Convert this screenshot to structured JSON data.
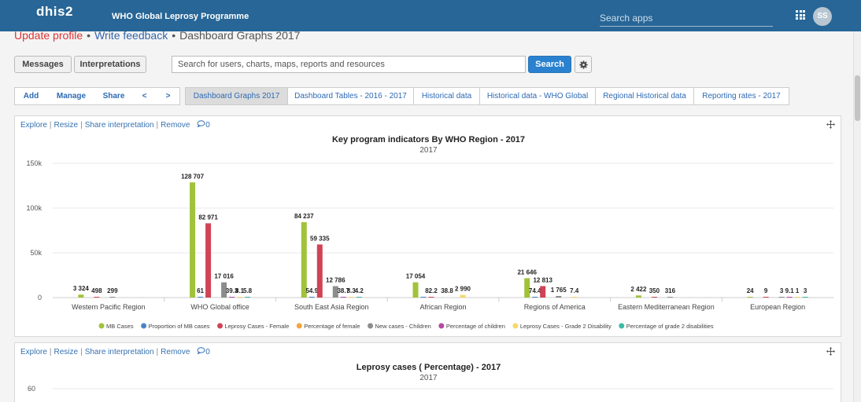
{
  "header": {
    "logo": "dhis2",
    "title": "WHO Global Leprosy Programme",
    "search_placeholder": "Search apps",
    "avatar_initials": "SS"
  },
  "breadcrumb": {
    "update_profile": "Update profile",
    "write_feedback": "Write feedback",
    "current": "Dashboard Graphs 2017",
    "separator": "•"
  },
  "toolbar": {
    "messages": "Messages",
    "interpretations": "Interpretations",
    "search_placeholder": "Search for users, charts, maps, reports and resources",
    "search_button": "Search"
  },
  "dashboard_controls": {
    "add": "Add",
    "manage": "Manage",
    "share": "Share",
    "prev": "<",
    "next": ">"
  },
  "tabs": [
    "Dashboard Graphs 2017",
    "Dashboard Tables - 2016 - 2017",
    "Historical data",
    "Historical data - WHO Global",
    "Regional Historical data",
    "Reporting rates - 2017"
  ],
  "panel_links": {
    "explore": "Explore",
    "resize": "Resize",
    "share_interpretation": "Share interpretation",
    "remove": "Remove",
    "comment_count": "0",
    "separator": "|"
  },
  "chart_data": [
    {
      "type": "bar",
      "title": "Key program indicators By WHO Region - 2017",
      "subtitle": "2017",
      "ylim": [
        0,
        150000
      ],
      "yticks": [
        0,
        50000,
        100000,
        150000
      ],
      "ytick_labels": [
        "0",
        "50k",
        "100k",
        "150k"
      ],
      "grid": true,
      "legend_position": "bottom",
      "categories": [
        "Western Pacific Region",
        "WHO Global office",
        "South East Asia Region",
        "African Region",
        "Regions of America",
        "Eastern Mediterranean Region",
        "European Region"
      ],
      "series": [
        {
          "name": "MB Cases",
          "color": "#a0c33a",
          "values": [
            3324,
            128707,
            84237,
            17054,
            21646,
            2422,
            24
          ]
        },
        {
          "name": "Proportion of MB cases",
          "color": "#4a84c7",
          "values": [
            null,
            61,
            54.9,
            82.2,
            74.4,
            null,
            null
          ]
        },
        {
          "name": "Leprosy Cases - Female",
          "color": "#d14356",
          "values": [
            498,
            82971,
            59335,
            38.8,
            12813,
            350,
            9
          ]
        },
        {
          "name": "Percentage of female",
          "color": "#f4a43c",
          "values": [
            null,
            null,
            null,
            null,
            null,
            null,
            null
          ]
        },
        {
          "name": "New cases - Children",
          "color": "#8d8d8d",
          "values": [
            299,
            17016,
            12786,
            null,
            1765,
            316,
            3
          ]
        },
        {
          "name": "Percentage of children",
          "color": "#b549a0",
          "values": [
            null,
            39.3,
            38.7,
            null,
            null,
            null,
            9.1
          ]
        },
        {
          "name": "Leprosy Cases - Grade 2 Disability",
          "color": "#f7d86a",
          "values": [
            null,
            8.1,
            8.3,
            2990,
            7.4,
            null,
            1
          ]
        },
        {
          "name": "Percentage of grade 2 disabilities",
          "color": "#3bbba4",
          "values": [
            null,
            5.8,
            4.2,
            null,
            null,
            null,
            3
          ]
        }
      ],
      "data_labels": [
        [
          "3 324",
          "",
          "498",
          "",
          "299",
          "",
          "",
          ""
        ],
        [
          "128 707",
          "61",
          "82 971",
          "",
          "17 016",
          "39.3",
          "8.1",
          "5.8"
        ],
        [
          "84 237",
          "54.9",
          "59 335",
          "",
          "12 786",
          "38.7",
          "8.3",
          "4.2"
        ],
        [
          "17 054",
          "",
          "82.2",
          "",
          "38.8",
          "",
          "2 990",
          ""
        ],
        [
          "21 646",
          "74.4",
          "12 813",
          "",
          "1 765",
          "",
          "7.4",
          ""
        ],
        [
          "2 422",
          "",
          "350",
          "",
          "316",
          "",
          "",
          ""
        ],
        [
          "24",
          "",
          "9",
          "",
          "3",
          "9.1",
          "1",
          "3"
        ]
      ]
    },
    {
      "type": "bar",
      "title": "Leprosy cases ( Percentage) - 2017",
      "subtitle": "2017",
      "yticks": [
        60
      ],
      "ytick_labels": [
        "60"
      ]
    }
  ]
}
